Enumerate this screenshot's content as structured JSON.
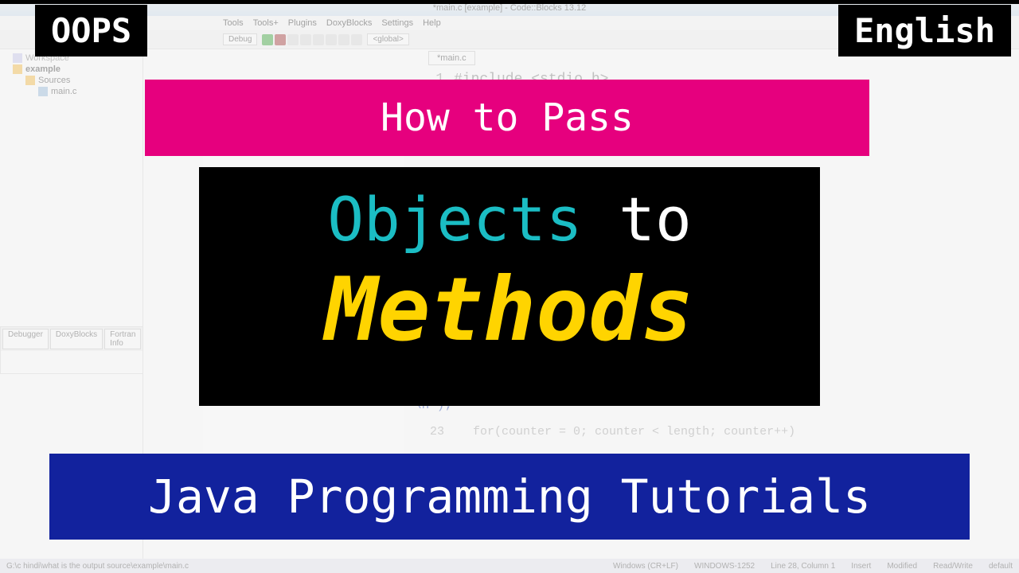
{
  "ide": {
    "title": "*main.c [example] - Code::Blocks 13.12",
    "menus": [
      "Tools",
      "Tools+",
      "Plugins",
      "DoxyBlocks",
      "Settings",
      "Help"
    ],
    "config": "Debug",
    "scope": "<global>",
    "workspace_label": "Workspace",
    "project": "example",
    "sources_label": "Sources",
    "file": "main.c",
    "editor_tab": "*main.c",
    "bottom_tabs": [
      "Debugger",
      "DoxyBlocks",
      "Fortran Info"
    ],
    "code": {
      "include": "#include <stdio.h>",
      "forline": "for(counter = 0; counter < length; counter++)",
      "snippet_end": "\\n\");"
    },
    "status_left": "G:\\c hindi\\what is the output source\\example\\main.c",
    "status_right": [
      "Windows (CR+LF)",
      "WINDOWS-1252",
      "Line 28, Column 1",
      "Insert",
      "Modified",
      "Read/Write",
      "default"
    ]
  },
  "overlay": {
    "top_left": "OOPS",
    "top_right": "English",
    "pink": "How to Pass",
    "black_word1": "Objects",
    "black_word2": "to",
    "black_line2": "Methods",
    "blue": "Java Programming Tutorials"
  }
}
